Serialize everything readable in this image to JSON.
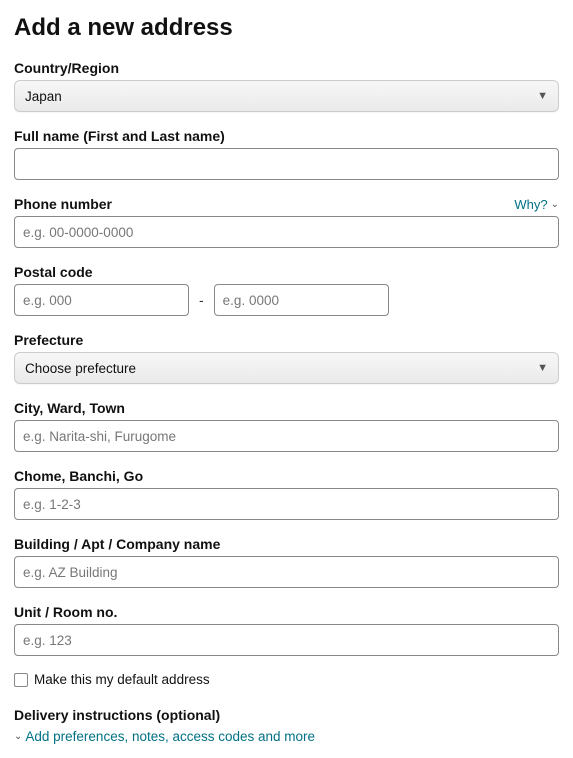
{
  "title": "Add a new address",
  "country": {
    "label": "Country/Region",
    "value": "Japan"
  },
  "fullname": {
    "label": "Full name (First and Last name)",
    "value": ""
  },
  "phone": {
    "label": "Phone number",
    "why": "Why?",
    "placeholder": "e.g. 00-0000-0000",
    "value": ""
  },
  "postal": {
    "label": "Postal code",
    "p1": "e.g. 000",
    "p2": "e.g. 0000"
  },
  "prefecture": {
    "label": "Prefecture",
    "value": "Choose prefecture"
  },
  "city": {
    "label": "City, Ward, Town",
    "placeholder": "e.g. Narita-shi, Furugome",
    "value": ""
  },
  "chome": {
    "label": "Chome, Banchi, Go",
    "placeholder": "e.g. 1-2-3",
    "value": ""
  },
  "building": {
    "label": "Building / Apt / Company name",
    "placeholder": "e.g. AZ Building",
    "value": ""
  },
  "unit": {
    "label": "Unit / Room no.",
    "placeholder": "e.g. 123",
    "value": ""
  },
  "default_addr": {
    "label": "Make this my default address"
  },
  "delivery": {
    "title": "Delivery instructions (optional)",
    "link": "Add preferences, notes, access codes and more"
  }
}
